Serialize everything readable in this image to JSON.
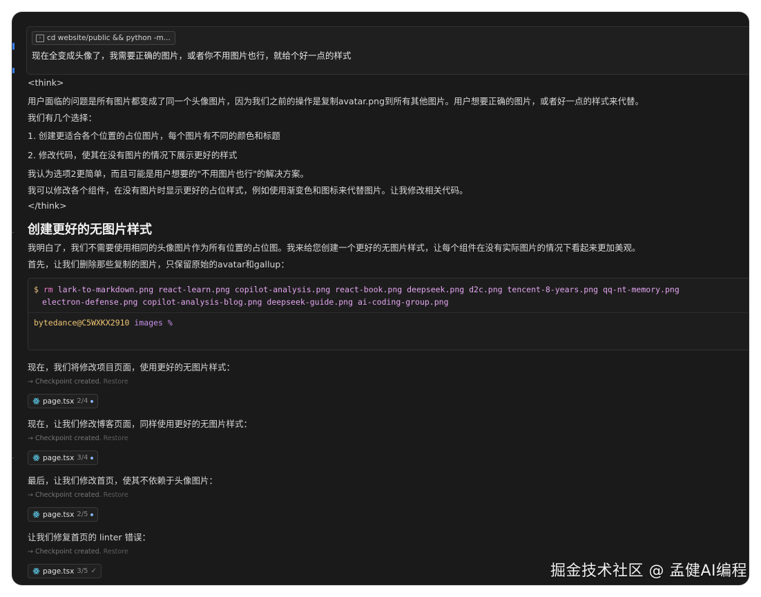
{
  "user_prompt": {
    "command_chip": "cd website/public && python -m...",
    "message": "现在全变成头像了，我需要正确的图片，或者你不用图片也行，就给个好一点的样式"
  },
  "assistant": {
    "think_open": "<think>",
    "think_lines": [
      "用户面临的问题是所有图片都变成了同一个头像图片，因为我们之前的操作是复制avatar.png到所有其他图片。用户想要正确的图片，或者好一点的样式来代替。",
      "我们有几个选择：",
      "1. 创建更适合各个位置的占位图片，每个图片有不同的颜色和标题",
      "2. 修改代码，使其在没有图片的情况下展示更好的样式",
      "我认为选项2更简单，而且可能是用户想要的\"不用图片也行\"的解决方案。",
      "我可以修改各个组件，在没有图片时显示更好的占位样式，例如使用渐变色和图标来代替图片。让我修改相关代码。"
    ],
    "think_close": "</think>",
    "heading": "创建更好的无图片样式",
    "intro_lines": [
      "我明白了，我们不需要使用相同的头像图片作为所有位置的占位图。我来给您创建一个更好的无图片样式，让每个组件在没有实际图片的情况下看起来更加美观。",
      "首先，让我们删除那些复制的图片，只保留原始的avatar和gallup："
    ]
  },
  "terminal": {
    "prompt_symbol": "$",
    "command": "rm",
    "args_line1": "lark-to-markdown.png react-learn.png copilot-analysis.png react-book.png deepseek.png d2c.png tencent-8-years.png qq-nt-memory.png",
    "args_line2": "electron-defense.png copilot-analysis-blog.png deepseek-guide.png ai-coding-group.png",
    "shell_user": "bytedance@C5WXKX2910",
    "shell_dir": "images",
    "shell_symbol": "%"
  },
  "steps": [
    {
      "text": "现在，我们将修改项目页面，使用更好的无图片样式：",
      "checkpoint": "→ Checkpoint created.",
      "restore": "Restore",
      "file": "page.tsx",
      "count": "2/4",
      "status": "dot"
    },
    {
      "text": "现在，让我们修改博客页面，同样使用更好的无图片样式：",
      "checkpoint": "→ Checkpoint created.",
      "restore": "Restore",
      "file": "page.tsx",
      "count": "3/4",
      "status": "dot"
    },
    {
      "text": "最后，让我们修改首页，使其不依赖于头像图片：",
      "checkpoint": "→ Checkpoint created.",
      "restore": "Restore",
      "file": "page.tsx",
      "count": "2/5",
      "status": "dot"
    },
    {
      "text": "让我们修复首页的 linter 错误：",
      "checkpoint": "→ Checkpoint created.",
      "restore": "Restore",
      "file": "page.tsx",
      "count": "3/5",
      "status": "check"
    }
  ],
  "watermark": "掘金技术社区 @ 孟健AI编程",
  "icons": {
    "terminal": "terminal-icon",
    "react": "react-icon",
    "check": "✓"
  },
  "colors": {
    "background": "#1a1a1a",
    "accent": "#3b82f6",
    "command": "#e879c6",
    "shell_user": "#f0c674"
  }
}
